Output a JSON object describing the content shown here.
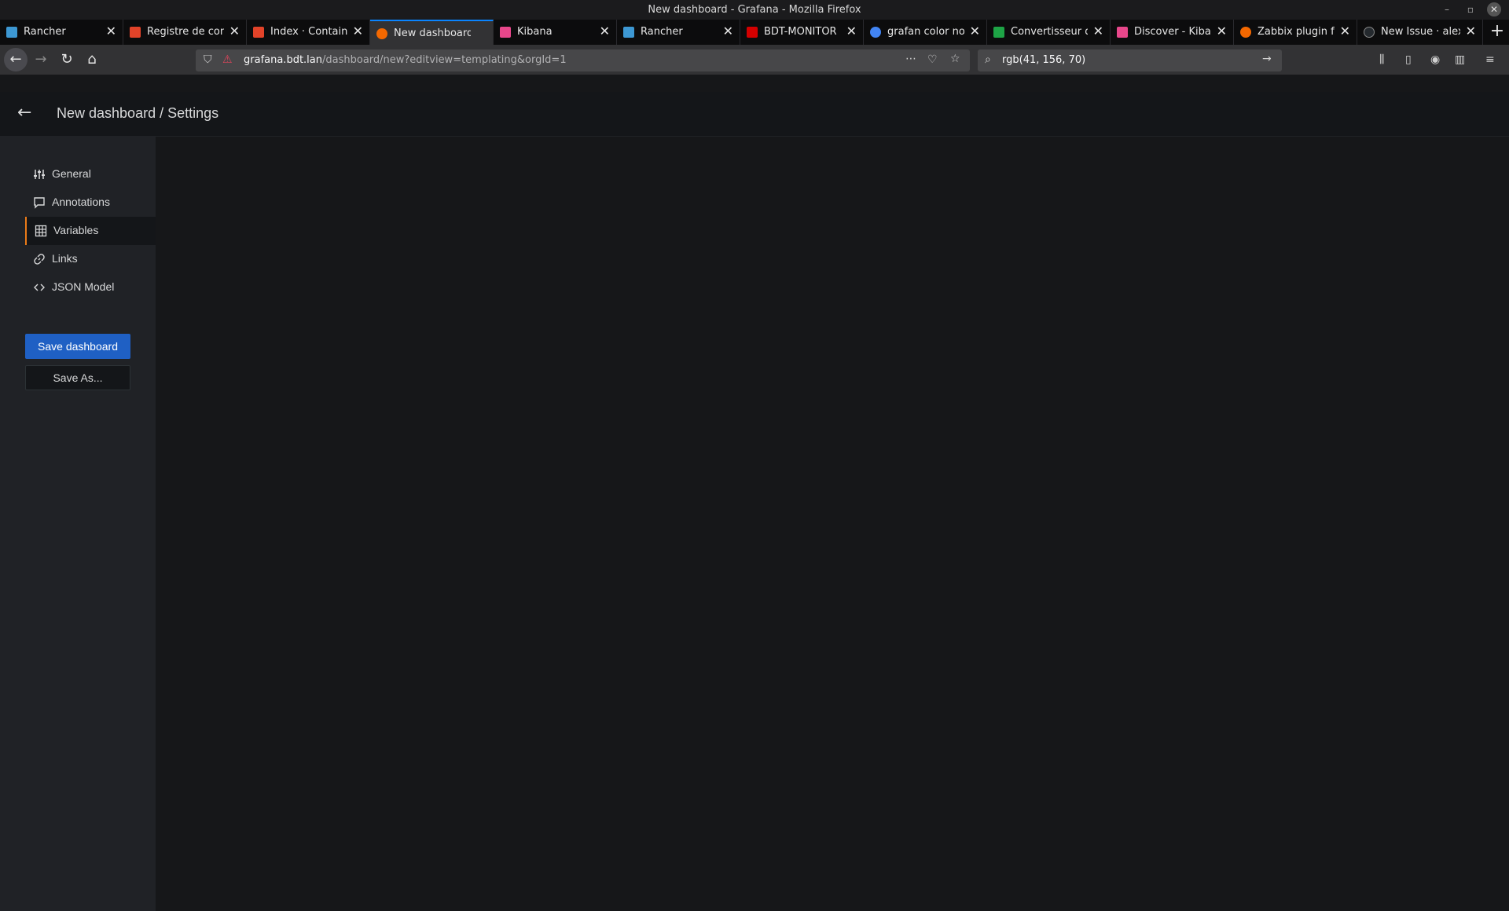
{
  "window": {
    "title": "New dashboard - Grafana - Mozilla Firefox"
  },
  "tabs": [
    {
      "label": "Rancher",
      "icon": "rancher-icon",
      "color": "#3d98d3"
    },
    {
      "label": "Registre de cont",
      "icon": "gitlab-icon",
      "color": "#e24329"
    },
    {
      "label": "Index · Containe",
      "icon": "gitlab-icon",
      "color": "#e24329"
    },
    {
      "label": "New dashboard",
      "icon": "grafana-icon",
      "color": "#f46800",
      "active": true
    },
    {
      "label": "Kibana",
      "icon": "kibana-icon",
      "color": "#e8478b"
    },
    {
      "label": "Rancher",
      "icon": "rancher-icon",
      "color": "#3d98d3"
    },
    {
      "label": "BDT-MONITOR",
      "icon": "zabbix-icon",
      "color": "#d40000"
    },
    {
      "label": "grafan color no",
      "icon": "google-icon",
      "color": "#4285f4"
    },
    {
      "label": "Convertisseur d",
      "icon": "converter-icon",
      "color": "#1ea446"
    },
    {
      "label": "Discover - Kiban",
      "icon": "kibana-icon",
      "color": "#e8478b"
    },
    {
      "label": "Zabbix plugin fo",
      "icon": "grafana-icon",
      "color": "#f46800"
    },
    {
      "label": "New Issue · alex",
      "icon": "github-icon",
      "color": "#24292e"
    }
  ],
  "nav": {
    "url_host": "grafana.bdt.lan",
    "url_path": "/dashboard/new?editview=templating&orgId=1",
    "search_value": "rgb(41, 156, 70)"
  },
  "page": {
    "title": "New dashboard / Settings",
    "menu": [
      {
        "label": "General",
        "icon": "sliders-icon"
      },
      {
        "label": "Annotations",
        "icon": "comment-icon"
      },
      {
        "label": "Variables",
        "icon": "table-icon",
        "active": true
      },
      {
        "label": "Links",
        "icon": "link-icon"
      },
      {
        "label": "JSON Model",
        "icon": "code-icon"
      }
    ],
    "save_label": "Save dashboard",
    "saveas_label": "Save As...",
    "accent": "#eb7b18",
    "primary": "#1f60c4"
  }
}
